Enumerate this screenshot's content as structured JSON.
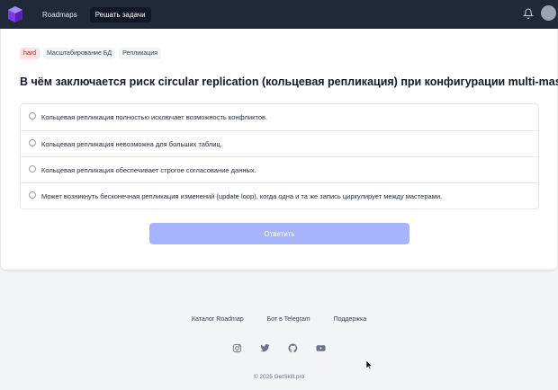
{
  "header": {
    "logo_icon": "getskill-logo-icon",
    "nav": [
      {
        "label": "Roadmaps",
        "active": false
      },
      {
        "label": "Решать задачи",
        "active": true
      }
    ],
    "notifications_icon": "bell-icon",
    "avatar_icon": "avatar"
  },
  "question": {
    "tags": [
      "hard",
      "Масштабирование БД",
      "Репликация"
    ],
    "title": "В чём заключается риск circular replication (кольцевая репликация) при конфигурации multi-master?",
    "options": [
      "Кольцевая репликация полностью исключает возможность конфликтов.",
      "Кольцевая репликация невозможна для больших таблиц.",
      "Кольцевая репликация обеспечивает строгое согласование данных.",
      "Может возникнуть бесконечная репликация изменений (update loop), когда одна и та же запись циркулирует между мастерами."
    ],
    "submit_label": "Ответить"
  },
  "footer": {
    "links": [
      "Каталог Roadmap",
      "Бот в Telegram",
      "Поддержка"
    ],
    "social_icons": [
      "instagram-icon",
      "twitter-icon",
      "github-icon",
      "youtube-icon"
    ],
    "copyright": "© 2025 GetSkill.pro"
  },
  "colors": {
    "navbar": "#1f2937",
    "accent_disabled": "#a5b4fc",
    "hard_tag_bg": "#fee2e2",
    "hard_tag_text": "#b91c1c"
  }
}
